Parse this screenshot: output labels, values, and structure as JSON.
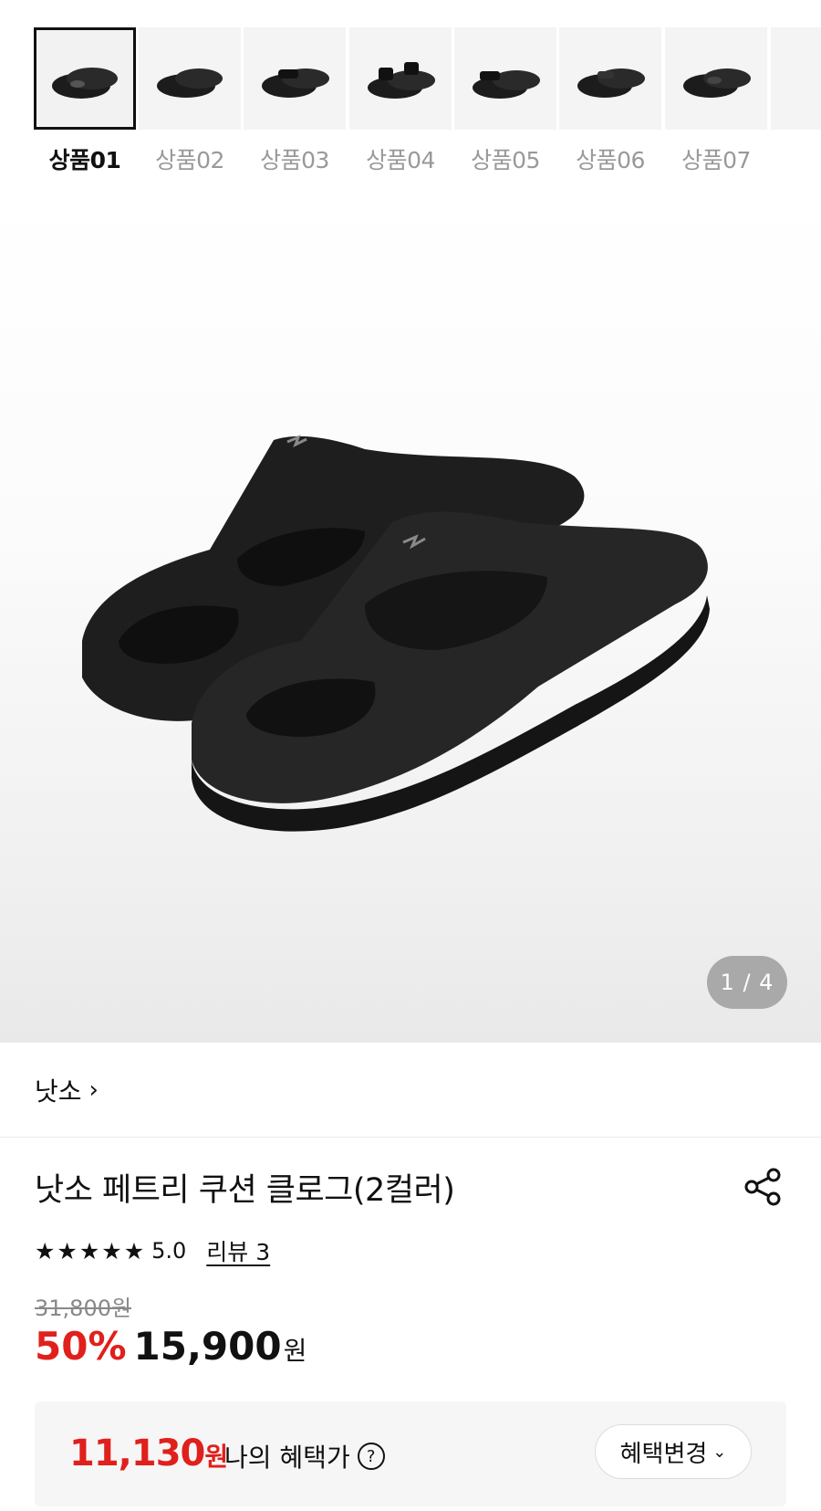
{
  "thumbnails": [
    {
      "label": "상품01",
      "selected": true
    },
    {
      "label": "상품02",
      "selected": false
    },
    {
      "label": "상품03",
      "selected": false
    },
    {
      "label": "상품04",
      "selected": false
    },
    {
      "label": "상품05",
      "selected": false
    },
    {
      "label": "상품06",
      "selected": false
    },
    {
      "label": "상품07",
      "selected": false
    }
  ],
  "gallery": {
    "pager": "1 / 4"
  },
  "brand": {
    "name": "낫소",
    "chevron": "›"
  },
  "product": {
    "title": "낫소 페트리 쿠션 클로그(2컬러)",
    "share_icon": "share-icon",
    "rating": {
      "stars": [
        "★",
        "★",
        "★",
        "★",
        "★"
      ],
      "score": "5.0",
      "review_link": "리뷰 3"
    },
    "original_price": "31,800원",
    "discount": "50%",
    "price": "15,900",
    "price_unit": "원"
  },
  "benefit": {
    "price": "11,130",
    "price_unit": "원",
    "label": "나의 혜택가",
    "help_symbol": "?",
    "change_button": "혜택변경",
    "change_chevron": "⌄"
  },
  "colors": {
    "accent_red": "#e0201c",
    "text": "#111111",
    "muted": "#999999",
    "pager_bg": "#a9a9a9"
  }
}
